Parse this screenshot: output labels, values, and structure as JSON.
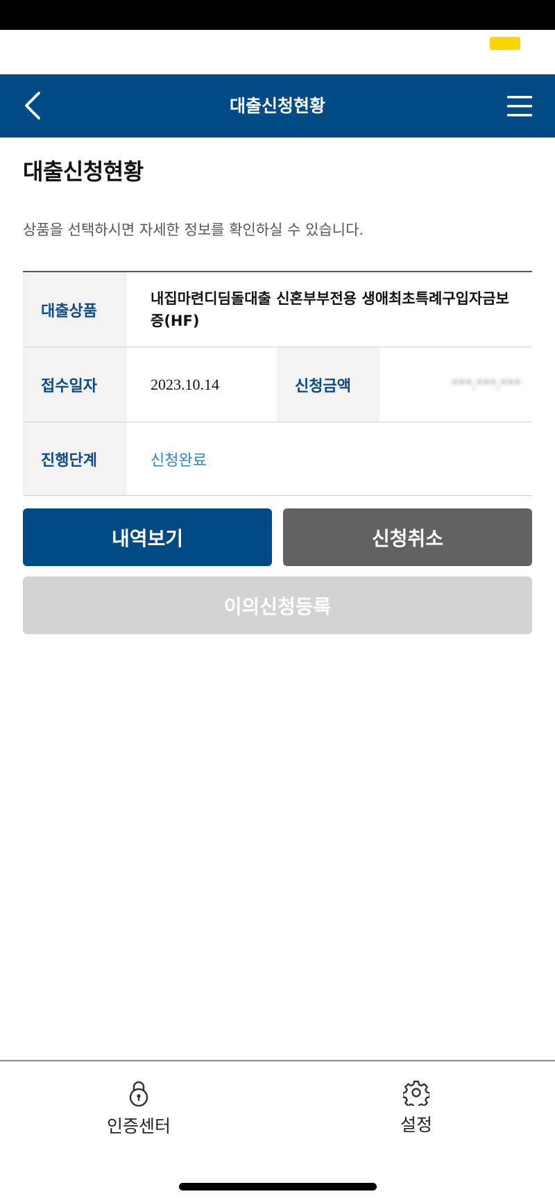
{
  "colors": {
    "primary": "#004a86",
    "cancel_button": "#626262",
    "disabled_button": "#d3d3d3",
    "status_text": "#2a84d0",
    "indicator": "#ffd500"
  },
  "header": {
    "title": "대출신청현황",
    "back_icon": "chevron-left-icon",
    "menu_icon": "hamburger-menu-icon"
  },
  "page": {
    "title": "대출신청현황",
    "description": "상품을 선택하시면 자세한 정보를 확인하실 수 있습니다."
  },
  "loan": {
    "product_label": "대출상품",
    "product_value": "내집마련디딤돌대출 신혼부부전용 생애최초특례구입자금보증(HF)",
    "date_label": "접수일자",
    "date_value": "2023.10.14",
    "amount_label": "신청금액",
    "amount_value": "***,***,***",
    "stage_label": "진행단계",
    "stage_value": "신청완료"
  },
  "actions": {
    "history_label": "내역보기",
    "cancel_label": "신청취소",
    "objection_label": "이의신청등록"
  },
  "bottom_nav": {
    "auth_label": "인증센터",
    "auth_icon": "lock-icon",
    "settings_label": "설정",
    "settings_icon": "gear-icon"
  }
}
